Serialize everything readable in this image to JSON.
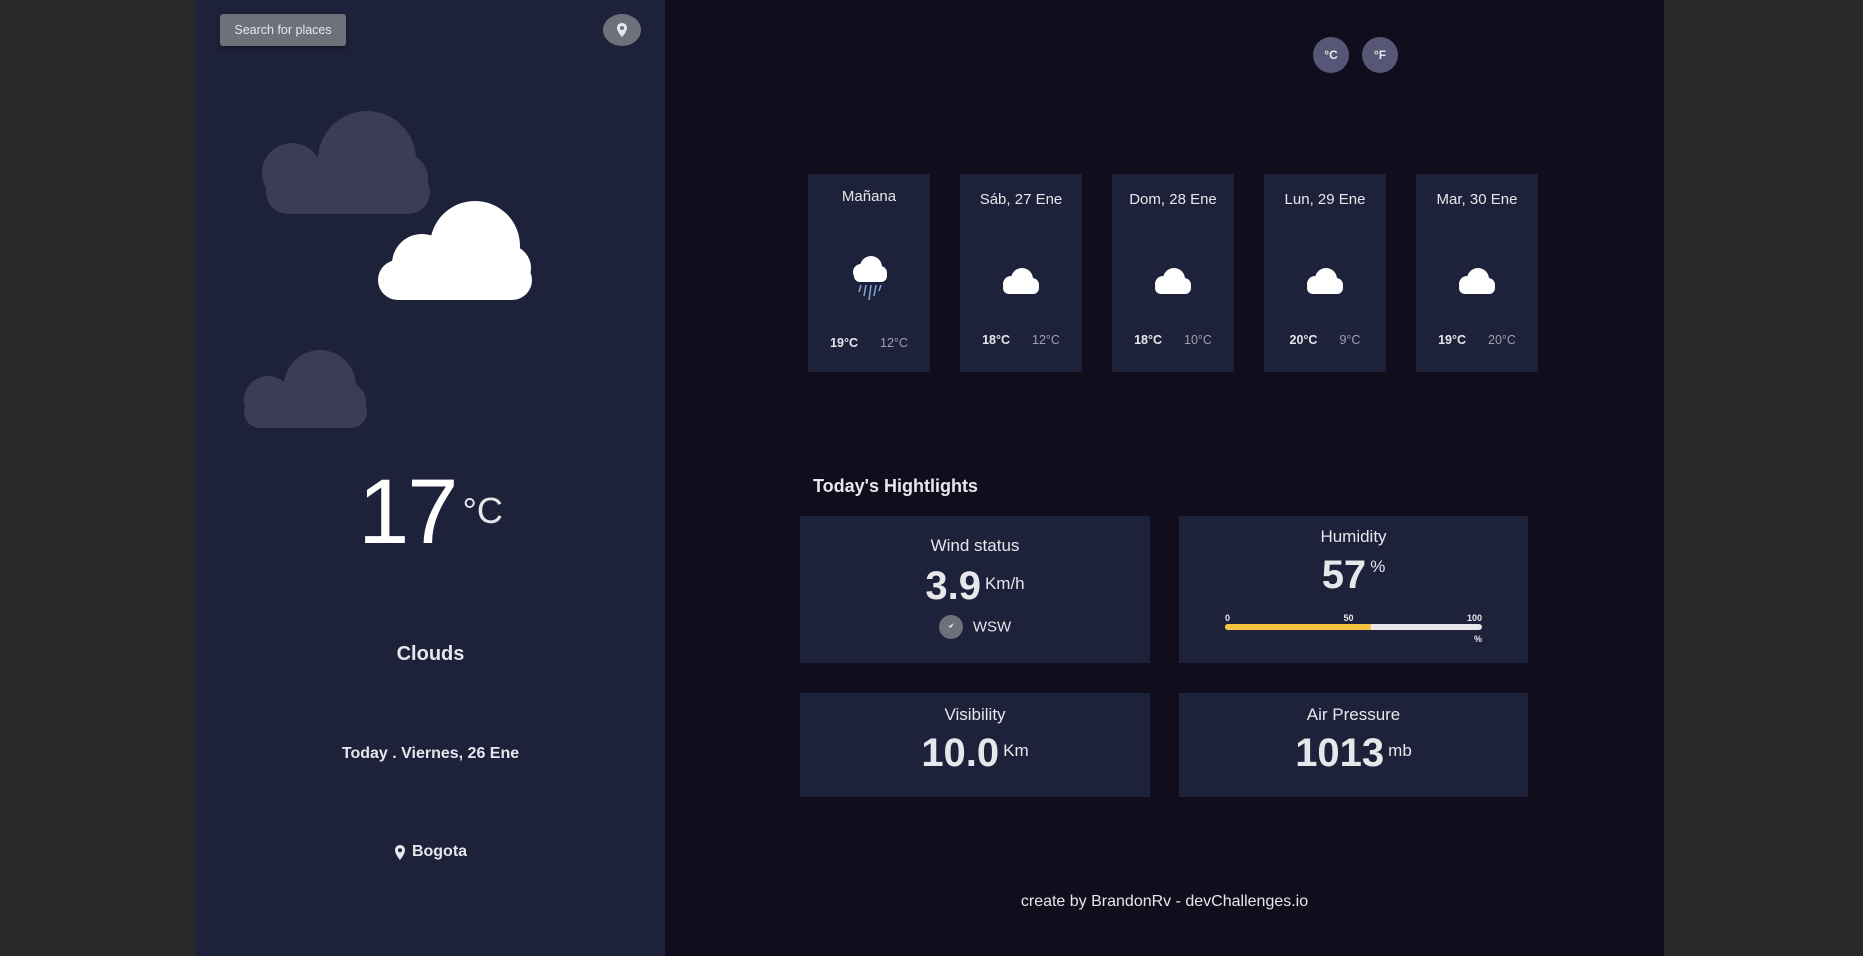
{
  "sidebar": {
    "search_label": "Search for places",
    "temperature": "17",
    "temperature_unit": "°C",
    "condition": "Clouds",
    "date": "Today . Viernes, 26 Ene",
    "location": "Bogota"
  },
  "units": {
    "celsius": "°C",
    "fahrenheit": "°F"
  },
  "forecast": [
    {
      "day": "Mañana",
      "icon": "rain-cloud-icon",
      "max": "19°C",
      "min": "12°C"
    },
    {
      "day": "Sáb, 27 Ene",
      "icon": "cloud-icon",
      "max": "18°C",
      "min": "12°C"
    },
    {
      "day": "Dom, 28 Ene",
      "icon": "cloud-icon",
      "max": "18°C",
      "min": "10°C"
    },
    {
      "day": "Lun, 29 Ene",
      "icon": "cloud-icon",
      "max": "20°C",
      "min": "9°C"
    },
    {
      "day": "Mar, 30 Ene",
      "icon": "cloud-icon",
      "max": "19°C",
      "min": "20°C"
    }
  ],
  "highlights": {
    "title": "Today's Hightlights",
    "wind": {
      "label": "Wind status",
      "value": "3.9",
      "unit": "Km/h",
      "direction": "WSW"
    },
    "humidity": {
      "label": "Humidity",
      "value": "57",
      "unit": "%",
      "tick_0": "0",
      "tick_50": "50",
      "tick_100": "100",
      "bar_unit": "%",
      "fraction": 0.57
    },
    "visibility": {
      "label": "Visibility",
      "value": "10.0",
      "unit": "Km"
    },
    "pressure": {
      "label": "Air Pressure",
      "value": "1013",
      "unit": "mb"
    }
  },
  "footer": "create by BrandonRv - devChallenges.io",
  "colors": {
    "bar_fill": "#f5c242",
    "sidebar_bg": "#1e213a",
    "main_bg": "#100e1d"
  }
}
